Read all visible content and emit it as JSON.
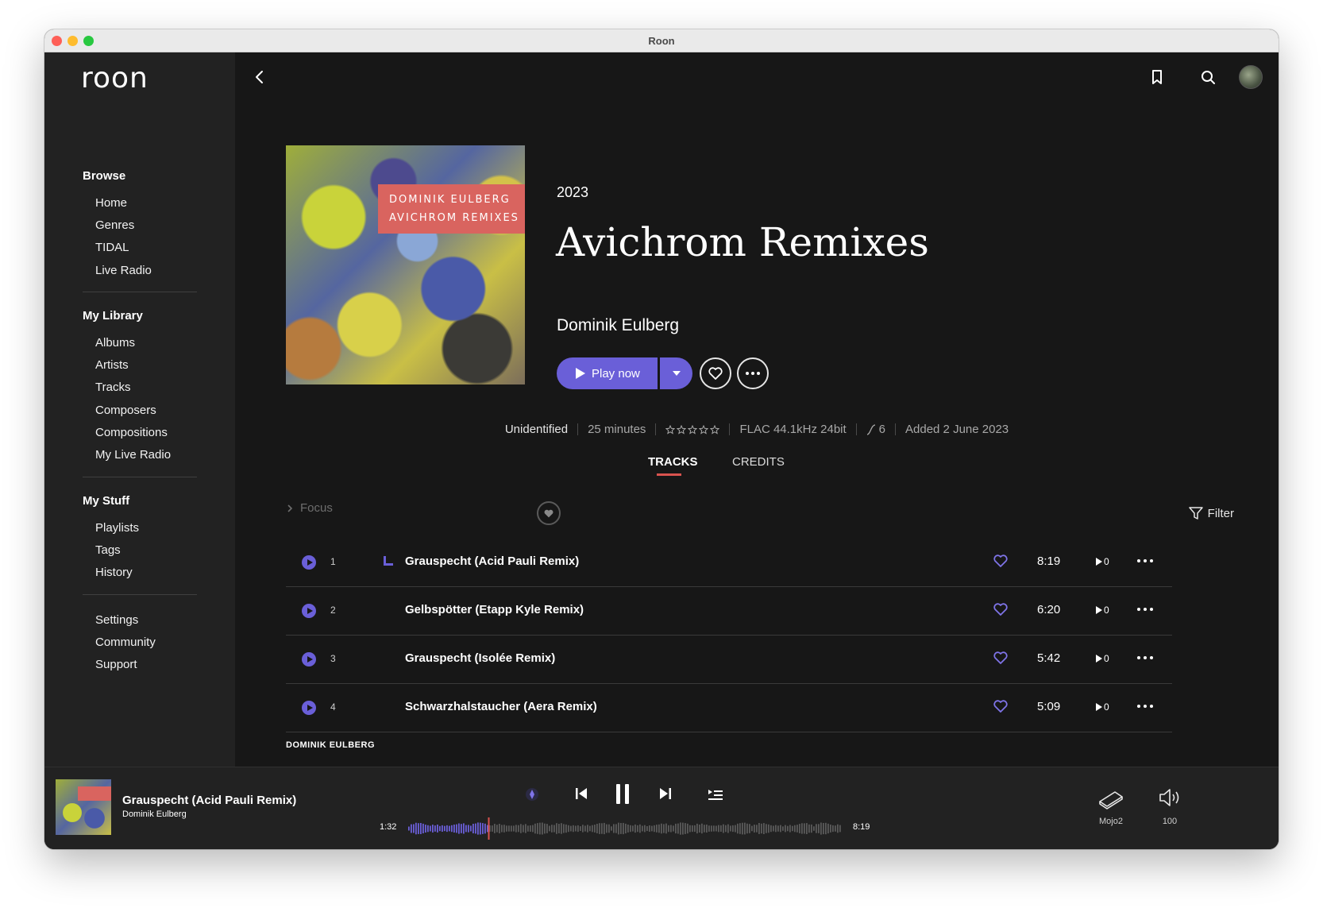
{
  "window": {
    "title": "Roon"
  },
  "sidebar": {
    "logo": "roon",
    "sections": [
      {
        "title": "Browse",
        "items": [
          "Home",
          "Genres",
          "TIDAL",
          "Live Radio"
        ]
      },
      {
        "title": "My Library",
        "items": [
          "Albums",
          "Artists",
          "Tracks",
          "Composers",
          "Compositions",
          "My Live Radio"
        ]
      },
      {
        "title": "My Stuff",
        "items": [
          "Playlists",
          "Tags",
          "History"
        ]
      },
      {
        "title": "",
        "items": [
          "Settings",
          "Community",
          "Support"
        ]
      }
    ]
  },
  "album": {
    "cover_text": [
      "DOMINIK EULBERG",
      "AVICHROM REMIXES"
    ],
    "year": "2023",
    "title": "Avichrom Remixes",
    "artist": "Dominik Eulberg",
    "play_label": "Play now",
    "meta": {
      "status": "Unidentified",
      "duration": "25 minutes",
      "rating_stars": 0,
      "rating_max": 5,
      "format": "FLAC 44.1kHz 24bit",
      "dynamic_range": "6",
      "added": "Added 2 June 2023"
    }
  },
  "tabs": [
    {
      "label": "TRACKS",
      "active": true
    },
    {
      "label": "CREDITS",
      "active": false
    }
  ],
  "track_toolbar": {
    "focus_label": "Focus",
    "filter_label": "Filter"
  },
  "tracks": [
    {
      "number": "1",
      "title": "Grauspecht (Acid Pauli Remix)",
      "duration": "8:19",
      "plays": "0",
      "now_playing": true
    },
    {
      "number": "2",
      "title": "Gelbspötter (Etapp Kyle Remix)",
      "duration": "6:20",
      "plays": "0",
      "now_playing": false
    },
    {
      "number": "3",
      "title": "Grauspecht (Isolée Remix)",
      "duration": "5:42",
      "plays": "0",
      "now_playing": false
    },
    {
      "number": "4",
      "title": "Schwarzhalstaucher (Aera Remix)",
      "duration": "5:09",
      "plays": "0",
      "now_playing": false
    }
  ],
  "next_section_label": "DOMINIK EULBERG",
  "now_playing": {
    "title": "Grauspecht (Acid Pauli Remix)",
    "artist": "Dominik Eulberg",
    "elapsed": "1:32",
    "total": "8:19",
    "progress_fraction": 0.184,
    "zone": "Mojo2",
    "volume": "100"
  },
  "colors": {
    "accent": "#6a5fd8",
    "tab_underline": "#d9534f",
    "background": "#171717",
    "sidebar": "#222222"
  }
}
